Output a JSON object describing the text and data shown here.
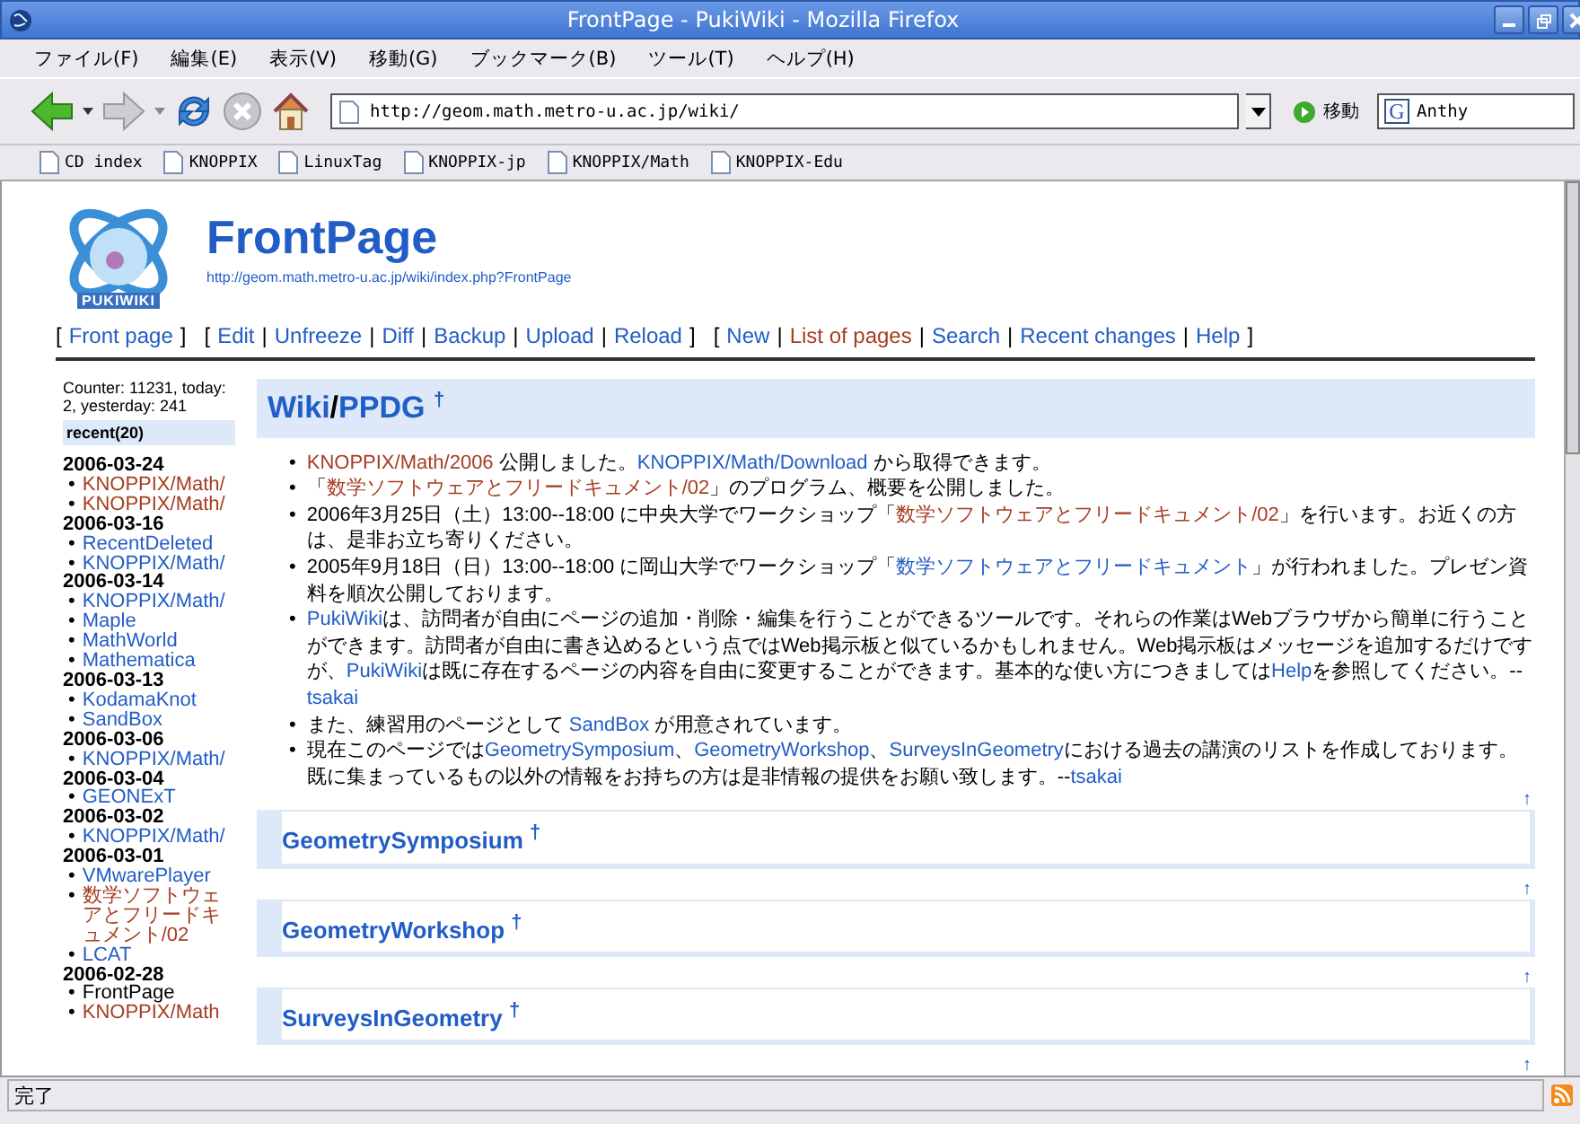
{
  "window": {
    "title": "FrontPage - PukiWiki - Mozilla Firefox"
  },
  "menu": [
    "ファイル(F)",
    "編集(E)",
    "表示(V)",
    "移動(G)",
    "ブックマーク(B)",
    "ツール(T)",
    "ヘルプ(H)"
  ],
  "toolbar": {
    "url": "http://geom.math.metro-u.ac.jp/wiki/",
    "go_label": "移動",
    "search_engine": "G",
    "search": "Anthy"
  },
  "bookmarks": [
    "CD index",
    "KNOPPIX",
    "LinuxTag",
    "KNOPPIX-jp",
    "KNOPPIX/Math",
    "KNOPPIX-Edu"
  ],
  "page": {
    "logo_text": "PUKIWIKI",
    "title": "FrontPage",
    "url": "http://geom.math.metro-u.ac.jp/wiki/index.php?FrontPage",
    "nav": [
      {
        "kind": "bracket",
        "text": "["
      },
      {
        "kind": "link",
        "text": "Front page",
        "visited": false
      },
      {
        "kind": "bracket",
        "text": "]"
      },
      {
        "kind": "bracket",
        "text": "["
      },
      {
        "kind": "link",
        "text": "Edit",
        "visited": false
      },
      {
        "kind": "sep",
        "text": "|"
      },
      {
        "kind": "link",
        "text": "Unfreeze",
        "visited": false
      },
      {
        "kind": "sep",
        "text": "|"
      },
      {
        "kind": "link",
        "text": "Diff",
        "visited": false
      },
      {
        "kind": "sep",
        "text": "|"
      },
      {
        "kind": "link",
        "text": "Backup",
        "visited": false
      },
      {
        "kind": "sep",
        "text": "|"
      },
      {
        "kind": "link",
        "text": "Upload",
        "visited": false
      },
      {
        "kind": "sep",
        "text": "|"
      },
      {
        "kind": "link",
        "text": "Reload",
        "visited": false
      },
      {
        "kind": "bracket",
        "text": "]"
      },
      {
        "kind": "bracket",
        "text": "["
      },
      {
        "kind": "link",
        "text": "New",
        "visited": false
      },
      {
        "kind": "sep",
        "text": "|"
      },
      {
        "kind": "link",
        "text": "List of pages",
        "visited": true
      },
      {
        "kind": "sep",
        "text": "|"
      },
      {
        "kind": "link",
        "text": "Search",
        "visited": false
      },
      {
        "kind": "sep",
        "text": "|"
      },
      {
        "kind": "link",
        "text": "Recent changes",
        "visited": false
      },
      {
        "kind": "sep",
        "text": "|"
      },
      {
        "kind": "link",
        "text": "Help",
        "visited": false
      },
      {
        "kind": "bracket",
        "text": "]"
      }
    ],
    "counter": "Counter: 11231, today: 2, yesterday: 241",
    "recent": {
      "title": "recent(20)",
      "days": [
        {
          "date": "2006-03-24",
          "items": [
            {
              "marker": "•",
              "label": "KNOPPIX/Math/",
              "visited": true,
              "current": false
            },
            {
              "marker": "•",
              "label": "KNOPPIX/Math/",
              "visited": true,
              "current": false
            }
          ]
        },
        {
          "date": "2006-03-16",
          "items": [
            {
              "marker": "•",
              "label": "RecentDeleted",
              "visited": false,
              "current": false
            },
            {
              "marker": "•",
              "label": "KNOPPIX/Math/",
              "visited": false,
              "current": false
            }
          ]
        },
        {
          "date": "2006-03-14",
          "items": [
            {
              "marker": "•",
              "label": "KNOPPIX/Math/",
              "visited": false,
              "current": false
            },
            {
              "marker": "•",
              "label": "Maple",
              "visited": false,
              "current": false
            },
            {
              "marker": "•",
              "label": "MathWorld",
              "visited": false,
              "current": false
            },
            {
              "marker": "•",
              "label": "Mathematica",
              "visited": false,
              "current": false
            }
          ]
        },
        {
          "date": "2006-03-13",
          "items": [
            {
              "marker": "•",
              "label": "KodamaKnot",
              "visited": false,
              "current": false
            },
            {
              "marker": "•",
              "label": "SandBox",
              "visited": false,
              "current": false
            }
          ]
        },
        {
          "date": "2006-03-06",
          "items": [
            {
              "marker": "•",
              "label": "KNOPPIX/Math/",
              "visited": false,
              "current": false
            }
          ]
        },
        {
          "date": "2006-03-04",
          "items": [
            {
              "marker": "•",
              "label": "GEONExT",
              "visited": false,
              "current": false
            }
          ]
        },
        {
          "date": "2006-03-02",
          "items": [
            {
              "marker": "•",
              "label": "KNOPPIX/Math/",
              "visited": false,
              "current": false
            }
          ]
        },
        {
          "date": "2006-03-01",
          "items": [
            {
              "marker": "•",
              "label": "VMwarePlayer",
              "visited": false,
              "current": false
            },
            {
              "marker": "•",
              "label": "数学ソフトウェアとフリードキュメント/02",
              "visited": true,
              "current": false
            },
            {
              "marker": "•",
              "label": "LCAT",
              "visited": false,
              "current": false
            }
          ]
        },
        {
          "date": "2006-02-28",
          "items": [
            {
              "marker": "•",
              "label": "FrontPage",
              "visited": false,
              "current": true
            },
            {
              "marker": "•",
              "label": "KNOPPIX/Math",
              "visited": true,
              "current": false
            }
          ]
        }
      ]
    },
    "heading": {
      "parts": [
        {
          "kind": "link",
          "text": "Wiki"
        },
        {
          "kind": "text",
          "text": "/"
        },
        {
          "kind": "link",
          "text": "PPDG"
        }
      ],
      "anchor": "†"
    },
    "bullets": [
      {
        "marker": "•",
        "segments": [
          {
            "kind": "link",
            "text": "KNOPPIX/Math/2006",
            "visited": true
          },
          {
            "kind": "text",
            "text": " 公開しました。"
          },
          {
            "kind": "link",
            "text": "KNOPPIX/Math/Download",
            "visited": false
          },
          {
            "kind": "text",
            "text": " から取得できます。"
          }
        ]
      },
      {
        "marker": "•",
        "segments": [
          {
            "kind": "text",
            "text": "「"
          },
          {
            "kind": "link",
            "text": "数学ソフトウェアとフリードキュメント/02",
            "visited": true
          },
          {
            "kind": "text",
            "text": "」のプログラム、概要を公開しました。"
          }
        ]
      },
      {
        "marker": "•",
        "segments": [
          {
            "kind": "text",
            "text": "2006年3月25日（土）13:00--18:00 に中央大学でワークショップ「"
          },
          {
            "kind": "link",
            "text": "数学ソフトウェアとフリードキュメント/02",
            "visited": true
          },
          {
            "kind": "text",
            "text": "」を行います。お近くの方は、是非お立ち寄りください。"
          }
        ]
      },
      {
        "marker": "•",
        "segments": [
          {
            "kind": "text",
            "text": "2005年9月18日（日）13:00--18:00 に岡山大学でワークショップ「"
          },
          {
            "kind": "link",
            "text": "数学ソフトウェアとフリードキュメント",
            "visited": false
          },
          {
            "kind": "text",
            "text": "」が行われました。プレゼン資料を順次公開しております。"
          }
        ]
      },
      {
        "marker": "•",
        "segments": [
          {
            "kind": "link",
            "text": "PukiWiki",
            "visited": false
          },
          {
            "kind": "text",
            "text": "は、訪問者が自由にページの追加・削除・編集を行うことができるツールです。それらの作業はWebブラウザから簡単に行うことができます。訪問者が自由に書き込めるという点ではWeb掲示板と似ているかもしれません。Web掲示板はメッセージを追加するだけですが、"
          },
          {
            "kind": "link",
            "text": "PukiWiki",
            "visited": false
          },
          {
            "kind": "text",
            "text": "は既に存在するページの内容を自由に変更することができます。基本的な使い方につきましては"
          },
          {
            "kind": "link",
            "text": "Help",
            "visited": false
          },
          {
            "kind": "text",
            "text": "を参照してください。--"
          },
          {
            "kind": "link",
            "text": "tsakai",
            "visited": false
          }
        ]
      },
      {
        "marker": "•",
        "segments": [
          {
            "kind": "text",
            "text": "また、練習用のページとして "
          },
          {
            "kind": "link",
            "text": "SandBox",
            "visited": false
          },
          {
            "kind": "text",
            "text": " が用意されています。"
          }
        ]
      },
      {
        "marker": "•",
        "segments": [
          {
            "kind": "text",
            "text": "現在このページでは"
          },
          {
            "kind": "link",
            "text": "GeometrySymposium",
            "visited": false
          },
          {
            "kind": "text",
            "text": "、"
          },
          {
            "kind": "link",
            "text": "GeometryWorkshop",
            "visited": false
          },
          {
            "kind": "text",
            "text": "、"
          },
          {
            "kind": "link",
            "text": "SurveysInGeometry",
            "visited": false
          },
          {
            "kind": "text",
            "text": "における過去の講演のリストを作成しております。既に集まっているもの以外の情報をお持ちの方は是非情報の提供をお願い致します。--"
          },
          {
            "kind": "link",
            "text": "tsakai",
            "visited": false
          }
        ]
      }
    ],
    "sections": [
      {
        "top": "↑",
        "title": "GeometrySymposium",
        "anchor": "†"
      },
      {
        "top": "↑",
        "title": "GeometryWorkshop",
        "anchor": "†"
      },
      {
        "top": "↑",
        "title": "SurveysInGeometry",
        "anchor": "†"
      }
    ],
    "bottom_top": "↑"
  },
  "status": "完了"
}
